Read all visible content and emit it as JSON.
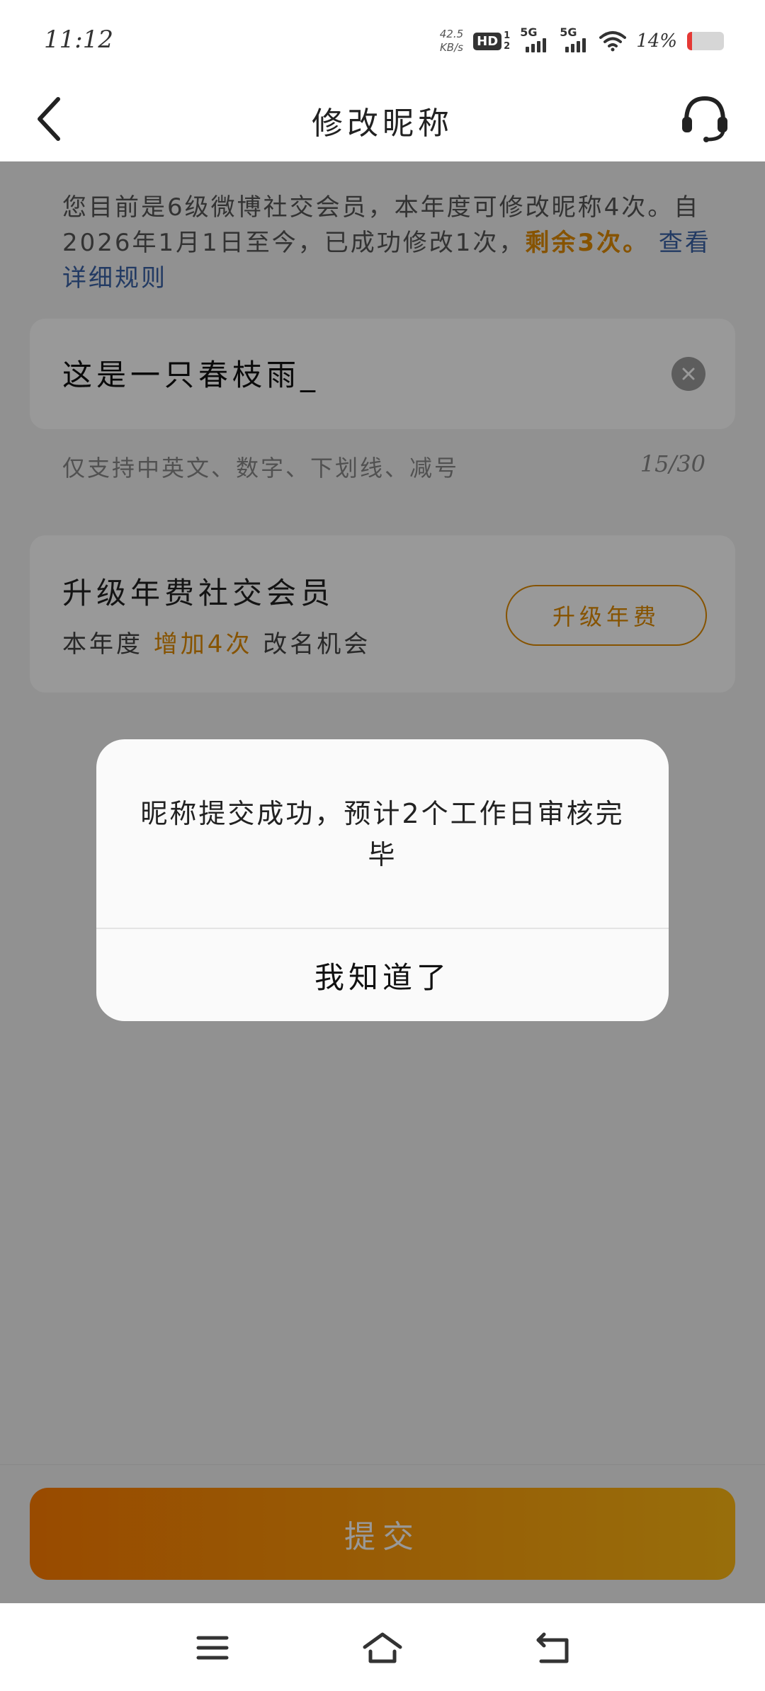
{
  "status_bar": {
    "time": "11:12",
    "net_speed_value": "42.5",
    "net_speed_unit": "KB/s",
    "hd_label": "HD",
    "hd_sim_top": "1",
    "hd_sim_bottom": "2",
    "signal1_label": "5G",
    "signal2_label": "5G",
    "battery_percent": "14%",
    "battery_level": 0.14
  },
  "header": {
    "title": "修改昵称",
    "back_icon": "chevron-left-icon",
    "service_icon": "headset-icon"
  },
  "info": {
    "line_prefix": "您目前是6级微博社交会员，本年度可修改昵称4次。自2026年1月1日至今，已成功修改1次，",
    "remaining": "剩余3次。",
    "rules_link": "查看详细规则"
  },
  "nickname": {
    "value": "这是一只春枝雨_",
    "clear_icon": "clear-icon"
  },
  "hint": {
    "text": "仅支持中英文、数字、下划线、减号",
    "counter": "15/30"
  },
  "upgrade": {
    "title": "升级年费社交会员",
    "sub_prefix": "本年度",
    "sub_highlight": "增加4次",
    "sub_suffix": "改名机会",
    "button": "升级年费"
  },
  "submit": {
    "label": "提交"
  },
  "dialog": {
    "message": "昵称提交成功，预计2个工作日审核完毕",
    "confirm": "我知道了"
  },
  "nav": {
    "menu_icon": "menu-icon",
    "home_icon": "home-icon",
    "back_icon": "back-icon"
  },
  "colors": {
    "accent": "#e08a00",
    "link": "#3a62a6",
    "submit_start": "#ff7d00",
    "submit_end": "#fdb813"
  }
}
